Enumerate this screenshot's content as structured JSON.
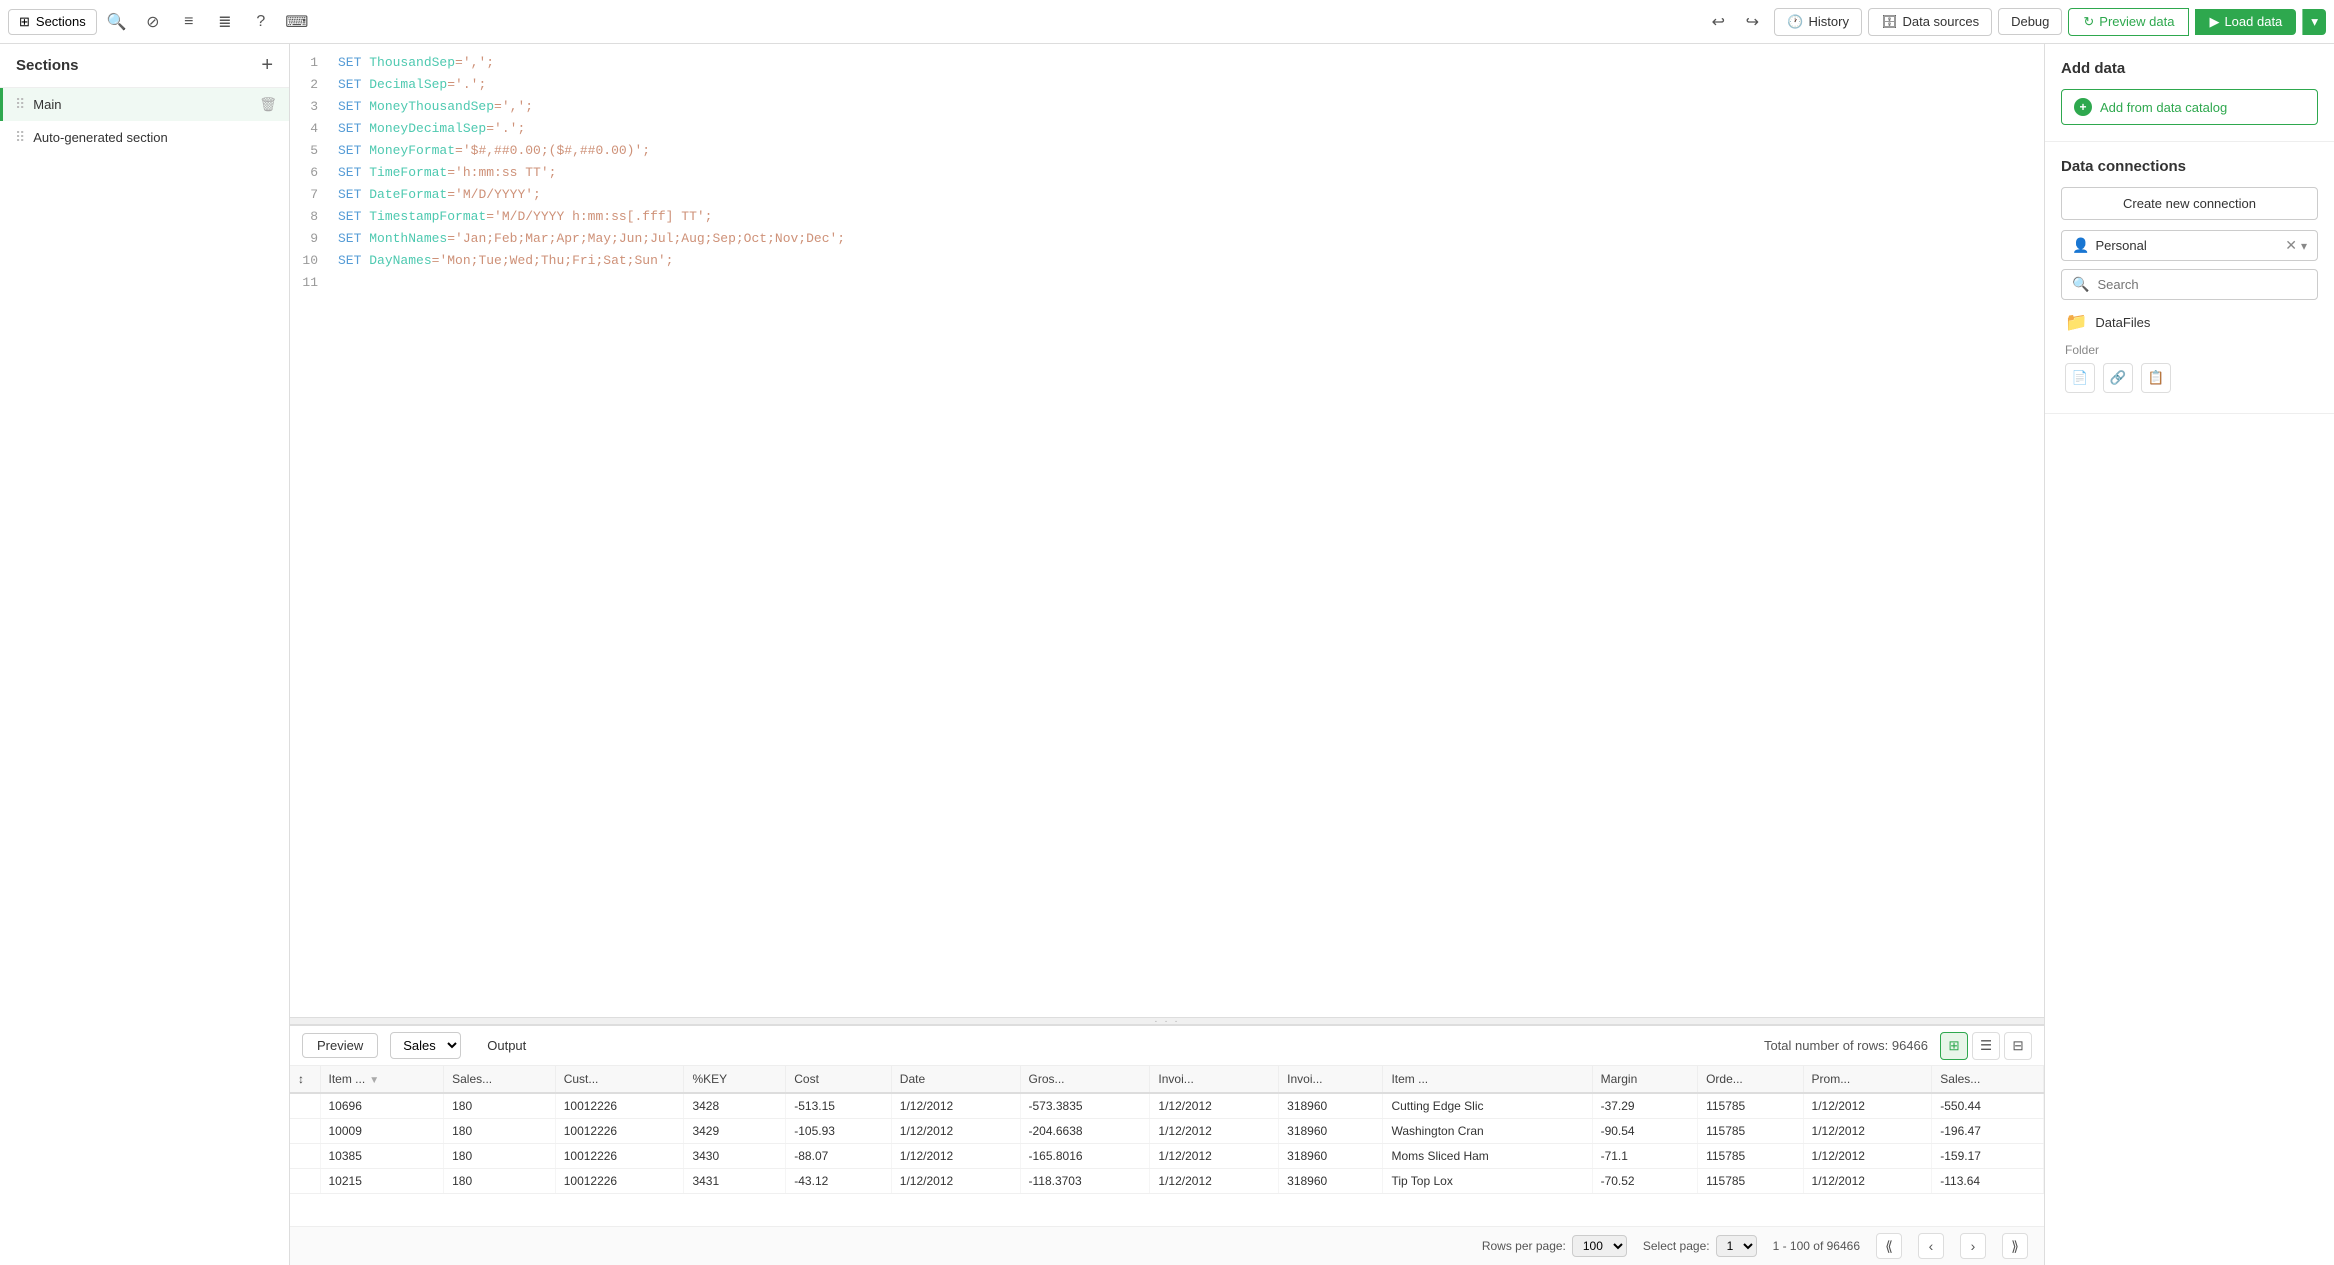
{
  "toolbar": {
    "sections_label": "Sections",
    "history_label": "History",
    "datasources_label": "Data sources",
    "debug_label": "Debug",
    "preview_label": "Preview data",
    "load_label": "Load data"
  },
  "sections_panel": {
    "title": "Sections",
    "items": [
      {
        "name": "Main",
        "active": true
      },
      {
        "name": "Auto-generated section",
        "active": false
      }
    ]
  },
  "editor": {
    "lines": [
      {
        "num": 1,
        "code": "SET ThousandSep=',';",
        "parts": [
          {
            "type": "kw",
            "text": "SET "
          },
          {
            "type": "var",
            "text": "ThousandSep"
          },
          {
            "type": "str",
            "text": "=',';"
          }
        ]
      },
      {
        "num": 2,
        "code": "SET DecimalSep='.';",
        "parts": [
          {
            "type": "kw",
            "text": "SET "
          },
          {
            "type": "var",
            "text": "DecimalSep"
          },
          {
            "type": "str",
            "text": "='.';"
          }
        ]
      },
      {
        "num": 3,
        "code": "SET MoneyThousandSep=',';",
        "parts": [
          {
            "type": "kw",
            "text": "SET "
          },
          {
            "type": "var",
            "text": "MoneyThousandSep"
          },
          {
            "type": "str",
            "text": "=',';"
          }
        ]
      },
      {
        "num": 4,
        "code": "SET MoneyDecimalSep='.';",
        "parts": [
          {
            "type": "kw",
            "text": "SET "
          },
          {
            "type": "var",
            "text": "MoneyDecimalSep"
          },
          {
            "type": "str",
            "text": "='.';"
          }
        ]
      },
      {
        "num": 5,
        "code": "SET MoneyFormat='$#,##0.00;($#,##0.00)';",
        "parts": [
          {
            "type": "kw",
            "text": "SET "
          },
          {
            "type": "var",
            "text": "MoneyFormat"
          },
          {
            "type": "str",
            "text": "='$#,##0.00;($#,##0.00)';"
          }
        ]
      },
      {
        "num": 6,
        "code": "SET TimeFormat='h:mm:ss TT';",
        "parts": [
          {
            "type": "kw",
            "text": "SET "
          },
          {
            "type": "var",
            "text": "TimeFormat"
          },
          {
            "type": "str",
            "text": "='h:mm:ss TT';"
          }
        ]
      },
      {
        "num": 7,
        "code": "SET DateFormat='M/D/YYYY';",
        "parts": [
          {
            "type": "kw",
            "text": "SET "
          },
          {
            "type": "var",
            "text": "DateFormat"
          },
          {
            "type": "str",
            "text": "='M/D/YYYY';"
          }
        ]
      },
      {
        "num": 8,
        "code": "SET TimestampFormat='M/D/YYYY h:mm:ss[.fff] TT';",
        "parts": [
          {
            "type": "kw",
            "text": "SET "
          },
          {
            "type": "var",
            "text": "TimestampFormat"
          },
          {
            "type": "str",
            "text": "='M/D/YYYY h:mm:ss[.fff] TT';"
          }
        ]
      },
      {
        "num": 9,
        "code": "SET MonthNames='Jan;Feb;Mar;Apr;May;Jun;Jul;Aug;Sep;Oct;Nov;Dec';",
        "parts": [
          {
            "type": "kw",
            "text": "SET "
          },
          {
            "type": "var",
            "text": "MonthNames"
          },
          {
            "type": "str",
            "text": "='Jan;Feb;Mar;Apr;May;Jun;Jul;Aug;Sep;Oct;Nov;Dec';"
          }
        ]
      },
      {
        "num": 10,
        "code": "SET DayNames='Mon;Tue;Wed;Thu;Fri;Sat;Sun';",
        "parts": [
          {
            "type": "kw",
            "text": "SET "
          },
          {
            "type": "var",
            "text": "DayNames"
          },
          {
            "type": "str",
            "text": "='Mon;Tue;Wed;Thu;Fri;Sat;Sun';"
          }
        ]
      },
      {
        "num": 11,
        "code": "",
        "parts": []
      }
    ]
  },
  "right_panel": {
    "add_data_title": "Add data",
    "add_catalog_label": "Add from data catalog",
    "data_connections_title": "Data connections",
    "create_connection_label": "Create new connection",
    "personal_label": "Personal",
    "search_placeholder": "Search",
    "datafiles_label": "DataFiles",
    "folder_label": "Folder"
  },
  "preview_panel": {
    "preview_label": "Preview",
    "output_label": "Output",
    "sales_option": "Sales",
    "total_rows_label": "Total number of rows: 96466",
    "table": {
      "columns": [
        "Item ...",
        "Sales...",
        "Cust...",
        "%KEY",
        "Cost",
        "Date",
        "Gros...",
        "Invoi...",
        "Invoi...",
        "Item ...",
        "Margin",
        "Orde...",
        "Prom...",
        "Sales..."
      ],
      "rows": [
        [
          "10696",
          "180",
          "10012226",
          "3428",
          "-513.15",
          "1/12/2012",
          "-573.3835",
          "1/12/2012",
          "318960",
          "Cutting Edge Slic",
          "-37.29",
          "115785",
          "1/12/2012",
          "-550.44"
        ],
        [
          "10009",
          "180",
          "10012226",
          "3429",
          "-105.93",
          "1/12/2012",
          "-204.6638",
          "1/12/2012",
          "318960",
          "Washington Cran",
          "-90.54",
          "115785",
          "1/12/2012",
          "-196.47"
        ],
        [
          "10385",
          "180",
          "10012226",
          "3430",
          "-88.07",
          "1/12/2012",
          "-165.8016",
          "1/12/2012",
          "318960",
          "Moms Sliced Ham",
          "-71.1",
          "115785",
          "1/12/2012",
          "-159.17"
        ],
        [
          "10215",
          "180",
          "10012226",
          "3431",
          "-43.12",
          "1/12/2012",
          "-118.3703",
          "1/12/2012",
          "318960",
          "Tip Top Lox",
          "-70.52",
          "115785",
          "1/12/2012",
          "-113.64"
        ]
      ]
    }
  },
  "pagination": {
    "rows_per_page_label": "Rows per page:",
    "rows_per_page_value": "100",
    "select_page_label": "Select page:",
    "select_page_value": "1",
    "page_info": "1 - 100 of 96466"
  }
}
